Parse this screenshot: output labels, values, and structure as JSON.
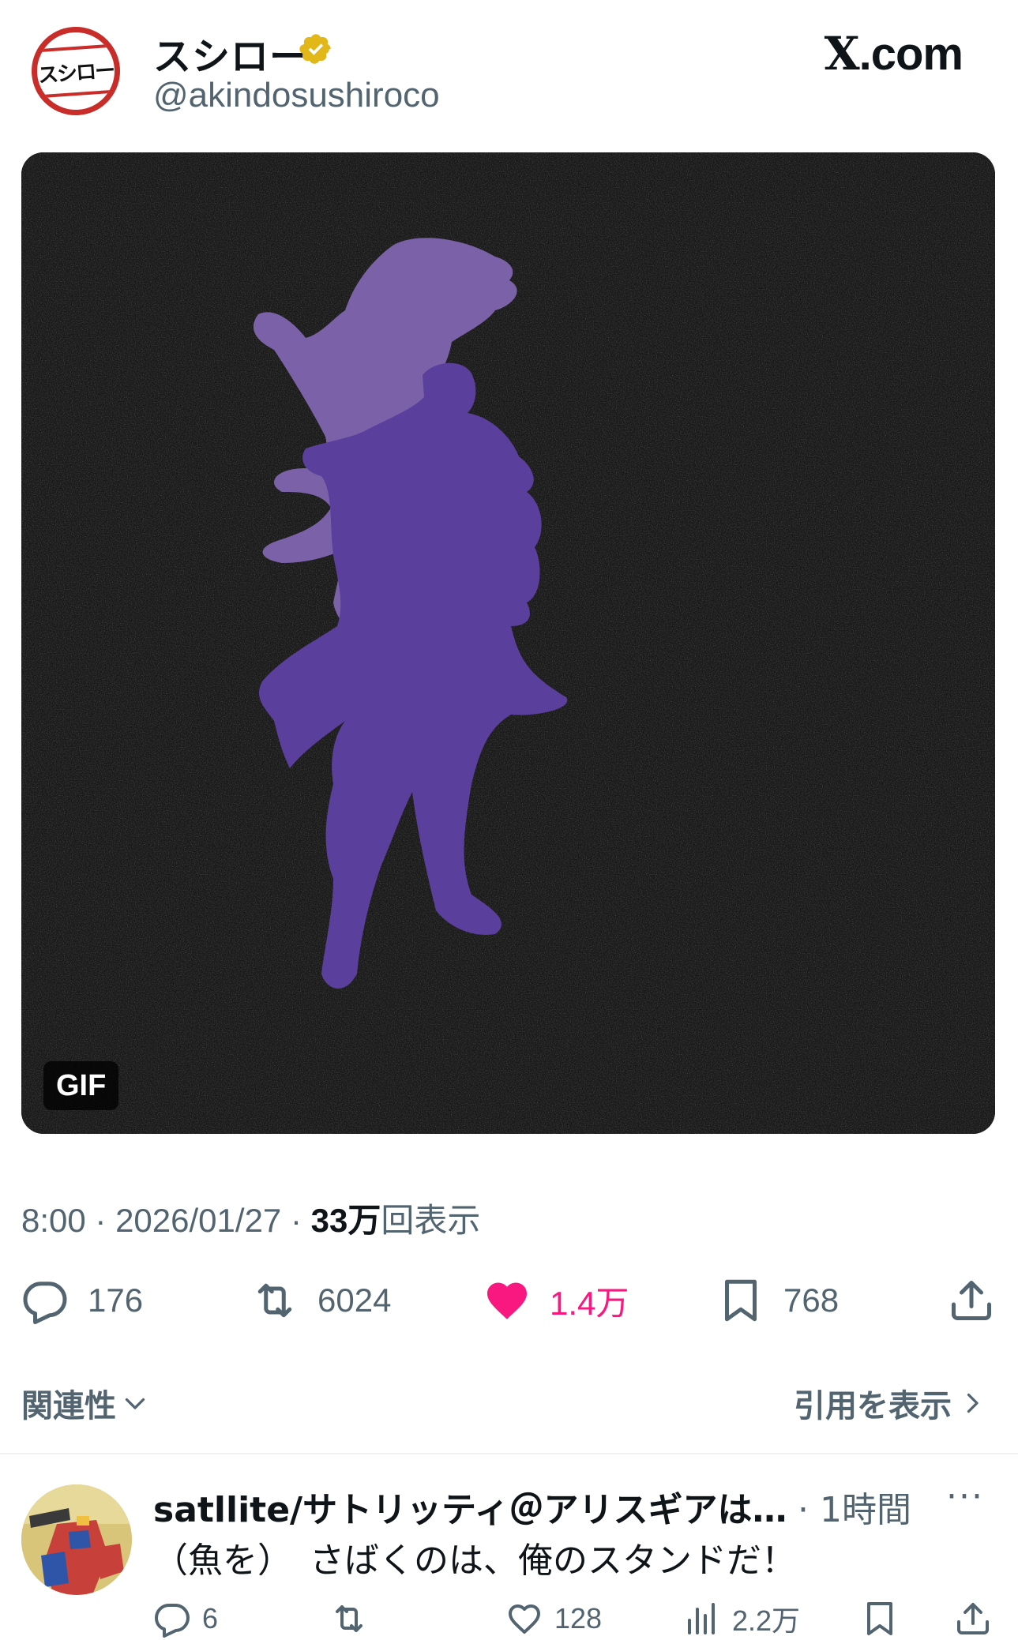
{
  "post": {
    "display_name": "スシロー",
    "handle": "@akindosushiroco",
    "avatar_text": "スシロー",
    "verified": true,
    "site_label": ".com",
    "site_mark": "X",
    "media_badge": "GIF",
    "time": "8:00",
    "separator": " · ",
    "date": "2026/01/27",
    "views_count": "33万",
    "views_label": "回表示"
  },
  "actions": {
    "replies": "176",
    "reposts": "6024",
    "likes": "1.4万",
    "bookmarks": "768"
  },
  "sort": {
    "label": "関連性",
    "quotes_link": "引用を表示"
  },
  "reply": {
    "name": "satllite/サトリッティ＠アリスギアは…",
    "time": "· 1時間",
    "more": "···",
    "text": "（魚を）　さばくのは、俺のスタンドだ！",
    "replies": "6",
    "reposts": "",
    "likes": "128",
    "views": "2.2万"
  },
  "colors": {
    "like_pink": "#f91880",
    "secondary_text": "#536471",
    "verified_gold": "#e2b719",
    "silhouette_light": "#7b62a8",
    "silhouette_dark": "#5a3f9c"
  }
}
